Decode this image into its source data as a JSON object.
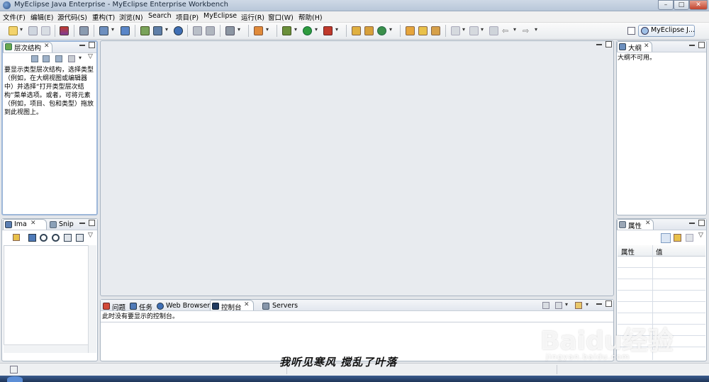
{
  "window": {
    "title": "MyEclipse Java Enterprise  -  MyEclipse Enterprise Workbench",
    "controls": {
      "minimize": "–",
      "maximize": "□",
      "close": "✕"
    }
  },
  "menubar": {
    "items": [
      "文件(F)",
      "编辑(E)",
      "源代码(S)",
      "重构(T)",
      "浏览(N)",
      "Search",
      "项目(P)",
      "MyEclipse",
      "运行(R)",
      "窗口(W)",
      "帮助(H)"
    ]
  },
  "perspective": {
    "label": "MyEclipse J..."
  },
  "hierarchy_view": {
    "tab_label": "层次结构",
    "message": "要显示类型层次结构，选择类型（例如，在大纲视图或编辑器中）并选择“打开类型层次结构”菜单选项。或者，可将元素（例如，项目、包和类型）拖放到此视图上。"
  },
  "image_view": {
    "tabs": [
      "Ima",
      "Snip"
    ]
  },
  "outline_view": {
    "tab_label": "大纲",
    "message": "大纲不可用。"
  },
  "properties_view": {
    "tab_label": "属性",
    "columns": [
      "属性",
      "值"
    ]
  },
  "console_view": {
    "tabs": [
      "问题",
      "任务",
      "Web Browser",
      "控制台",
      "Servers"
    ],
    "message": "此时没有要显示的控制台。"
  },
  "overlay": {
    "caption": "我听见寒风 搅乱了叶落",
    "watermark_main": "Baidu经验",
    "watermark_sub": "jingyan.baidu.com"
  },
  "colors": {
    "active_border": "#9db7d9",
    "taskbar": "#1e3558"
  }
}
